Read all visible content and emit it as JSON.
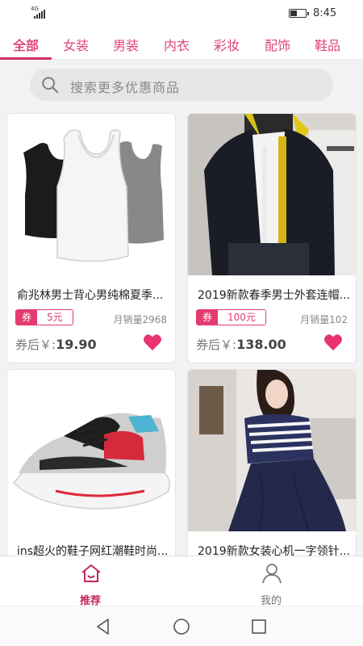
{
  "status_bar": {
    "network": "4G",
    "time": "8:45"
  },
  "tabs": [
    {
      "label": "全部"
    },
    {
      "label": "女装"
    },
    {
      "label": "男装"
    },
    {
      "label": "内衣"
    },
    {
      "label": "彩妆"
    },
    {
      "label": "配饰"
    },
    {
      "label": "鞋品"
    }
  ],
  "search": {
    "placeholder": "搜索更多优惠商品"
  },
  "products": [
    {
      "title": "俞兆林男士背心男纯棉夏季...",
      "coupon_label": "券",
      "coupon_value": "5元",
      "sales": "月销量2968",
      "price_label": "券后￥:",
      "price": "19.90"
    },
    {
      "title": "2019新款春季男士外套连帽...",
      "coupon_label": "券",
      "coupon_value": "100元",
      "sales": "月销量102",
      "price_label": "券后￥:",
      "price": "138.00"
    },
    {
      "title": "ins超火的鞋子网红潮鞋时尚..."
    },
    {
      "title": "2019新款女装心机一字领针..."
    }
  ],
  "bottom_nav": {
    "home_label": "推荐",
    "mine_label": "我的"
  },
  "colors": {
    "accent": "#e0457b",
    "accent_dark": "#c2285e",
    "heart": "#e8336f"
  },
  "icons": [
    "search-icon",
    "heart-icon",
    "home-icon",
    "user-icon",
    "back-icon",
    "home-circle-icon",
    "recents-icon"
  ]
}
